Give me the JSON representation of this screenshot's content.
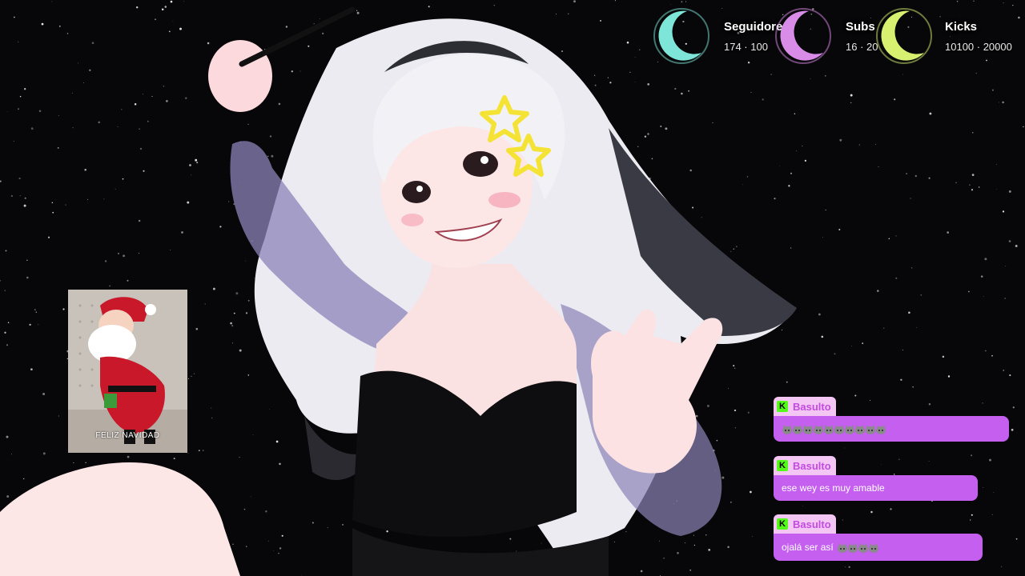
{
  "goals": [
    {
      "label": "Seguidores",
      "count": "174 · 100",
      "moon_color": "#7ee6d8"
    },
    {
      "label": "Subs",
      "count": "16 · 20",
      "moon_color": "#d98be8"
    },
    {
      "label": "Kicks",
      "count": "10100 · 20000",
      "moon_color": "#d8f070"
    }
  ],
  "gif": {
    "caption": "FELIZ NAVIDAD"
  },
  "chat": {
    "badge_letter": "K",
    "messages": [
      {
        "user": "Basulto",
        "text": "",
        "emotes": 10
      },
      {
        "user": "Basulto",
        "text": "ese wey es muy amable",
        "emotes": 0
      },
      {
        "user": "Basulto",
        "text": "ojalá ser así",
        "emotes": 4
      }
    ]
  },
  "colors": {
    "background": "#070709",
    "chat_bubble": "#c45ff0",
    "chat_name_tag": "#f4c6f4",
    "kick_green": "#53fc18"
  }
}
